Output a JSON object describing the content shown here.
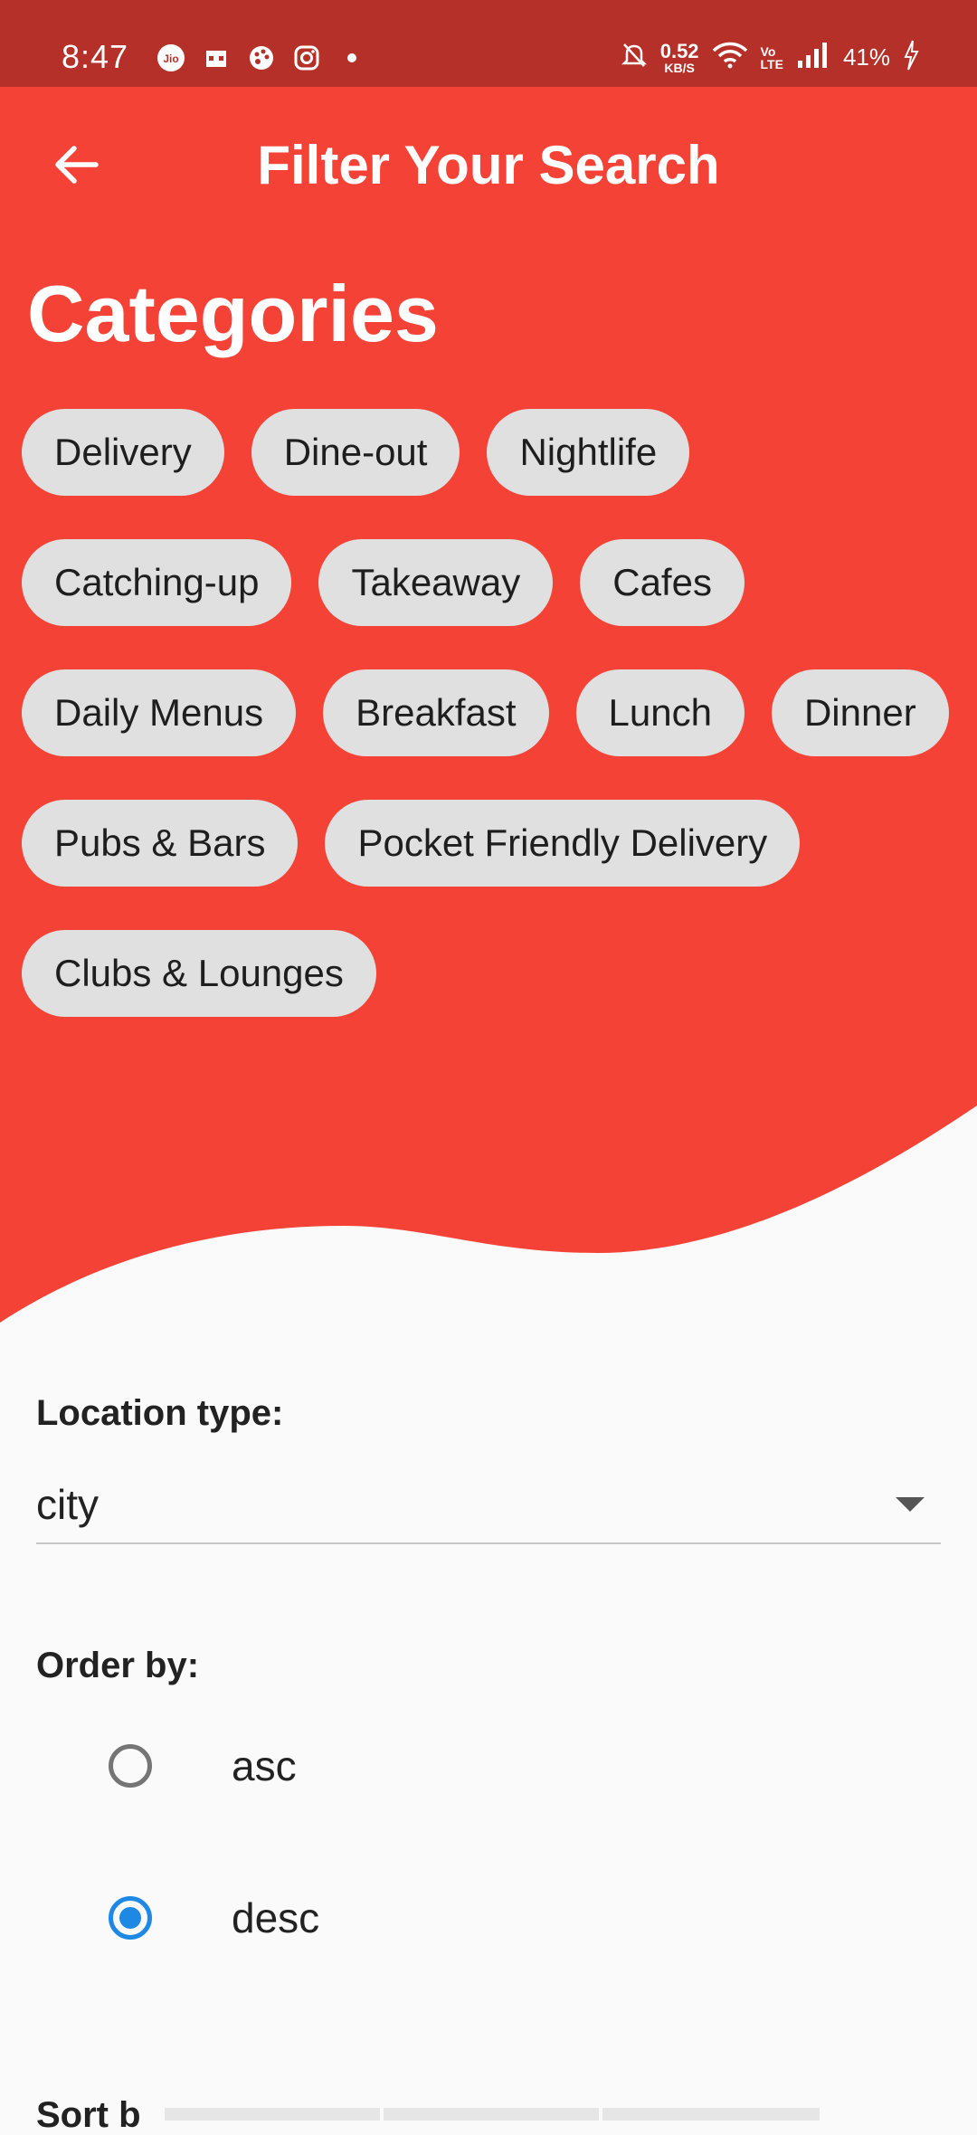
{
  "status_bar": {
    "time": "8:47",
    "net_speed_value": "0.52",
    "net_speed_unit": "KB/S",
    "volte_top": "Vo",
    "volte_bottom": "LTE",
    "battery": "41%",
    "bar_color": "#b53028"
  },
  "header": {
    "title": "Filter Your Search",
    "back_icon": "arrow-left-icon",
    "background_color": "#f44336"
  },
  "categories": {
    "title": "Categories",
    "chips": [
      "Delivery",
      "Dine-out",
      "Nightlife",
      "Catching-up",
      "Takeaway",
      "Cafes",
      "Daily Menus",
      "Breakfast",
      "Lunch",
      "Dinner",
      "Pubs & Bars",
      "Pocket Friendly Delivery",
      "Clubs & Lounges"
    ]
  },
  "location_type": {
    "label": "Location type:",
    "selected": "city"
  },
  "order_by": {
    "label": "Order by:",
    "options": [
      {
        "label": "asc",
        "checked": false
      },
      {
        "label": "desc",
        "checked": true
      }
    ],
    "accent_color": "#1e88e5"
  },
  "sort_by": {
    "label": "Sort b"
  }
}
